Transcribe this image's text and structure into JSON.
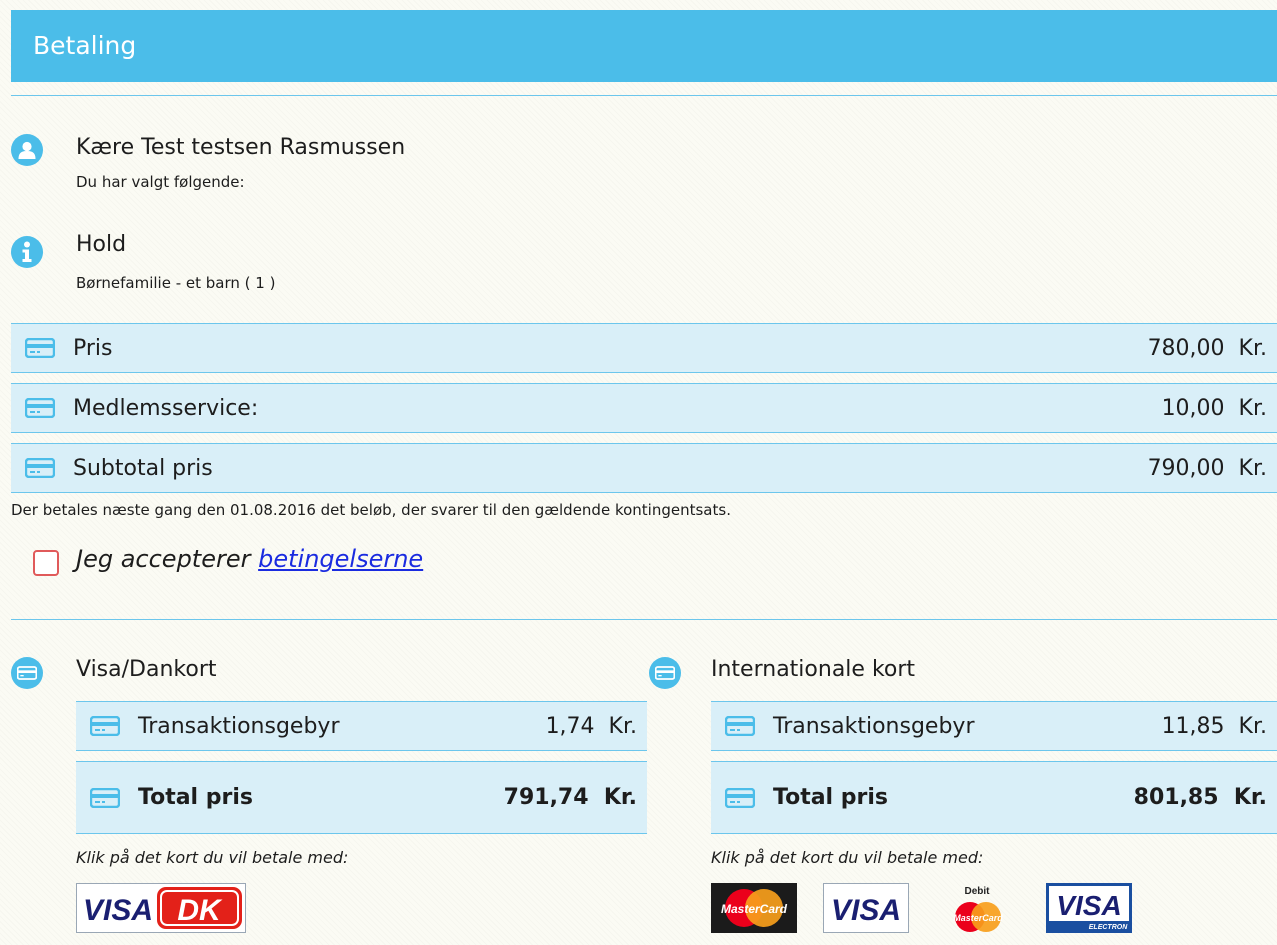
{
  "header": {
    "title": "Betaling"
  },
  "greeting": {
    "title": "Kære Test testsen Rasmussen",
    "subtitle": "Du har valgt følgende:"
  },
  "hold": {
    "title": "Hold",
    "subtitle": "Børnefamilie - et barn ( 1 )"
  },
  "price_rows": [
    {
      "label": "Pris",
      "amount": "780,00",
      "currency": "Kr."
    },
    {
      "label": "Medlemsservice:",
      "amount": "10,00",
      "currency": "Kr."
    },
    {
      "label": "Subtotal pris",
      "amount": "790,00",
      "currency": "Kr."
    }
  ],
  "notice": "Der betales næste gang den   01.08.2016 det beløb, der svarer til den gældende kontingentsats.",
  "terms": {
    "prefix": "Jeg accepterer ",
    "link": "betingelserne",
    "checked": false
  },
  "payment_options": [
    {
      "title": "Visa/Dankort",
      "fee": {
        "label": "Transaktionsgebyr",
        "amount": "1,74",
        "currency": "Kr."
      },
      "total": {
        "label": "Total pris",
        "amount": "791,74",
        "currency": "Kr."
      },
      "hint": "Klik på det kort du vil betale med:",
      "cards": [
        "visa-dankort-logo"
      ]
    },
    {
      "title": "Internationale kort",
      "fee": {
        "label": "Transaktionsgebyr",
        "amount": "11,85",
        "currency": "Kr."
      },
      "total": {
        "label": "Total pris",
        "amount": "801,85",
        "currency": "Kr."
      },
      "hint": "Klik på det kort du vil betale med:",
      "cards": [
        "mastercard-logo",
        "visa-logo",
        "debit-mastercard-logo",
        "visa-electron-logo"
      ]
    }
  ],
  "logo_text": {
    "visa": "VISA",
    "dankort": "DK",
    "mastercard": "MasterCard",
    "debit": "Debit",
    "electron": "ELECTRON"
  },
  "colors": {
    "accent": "#4bbde9",
    "row_bg": "#d9eff8",
    "row_border": "#6cc6ec",
    "checkbox_border": "#e05a5a",
    "link": "#1a2be0",
    "visa_blue": "#1a1f71",
    "dankort_red": "#e32119",
    "mastercard_red": "#eb001b",
    "mastercard_orange": "#f79e1b"
  }
}
